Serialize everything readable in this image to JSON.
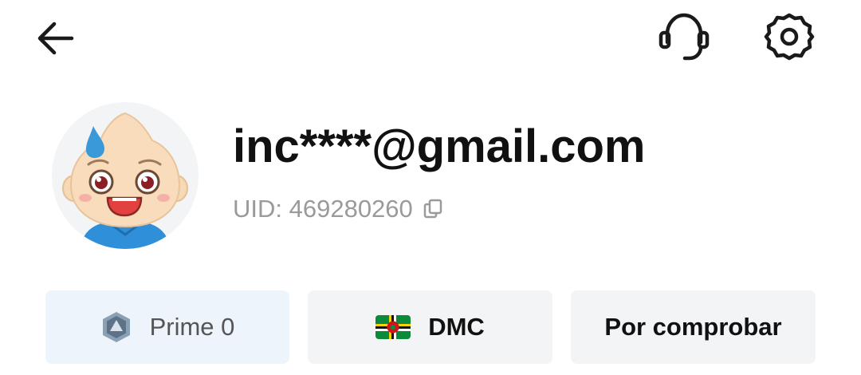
{
  "header": {
    "back_icon": "arrow-left-icon",
    "support_icon": "headset-icon",
    "settings_icon": "gear-icon"
  },
  "profile": {
    "avatar_icon": "cartoon-baby-avatar",
    "email": "inc****@gmail.com",
    "uid_text": "UID: 469280260",
    "copy_icon": "copy-icon"
  },
  "chips": {
    "prime": {
      "icon": "prime-badge-icon",
      "label": "Prime 0"
    },
    "country": {
      "icon": "dominica-flag-icon",
      "label": "DMC"
    },
    "verification": {
      "label": "Por comprobar"
    }
  },
  "colors": {
    "text_primary": "#111111",
    "text_secondary": "#9a9a9a",
    "prime_chip_bg": "#eef4fb",
    "chip_bg": "#f3f4f6"
  }
}
